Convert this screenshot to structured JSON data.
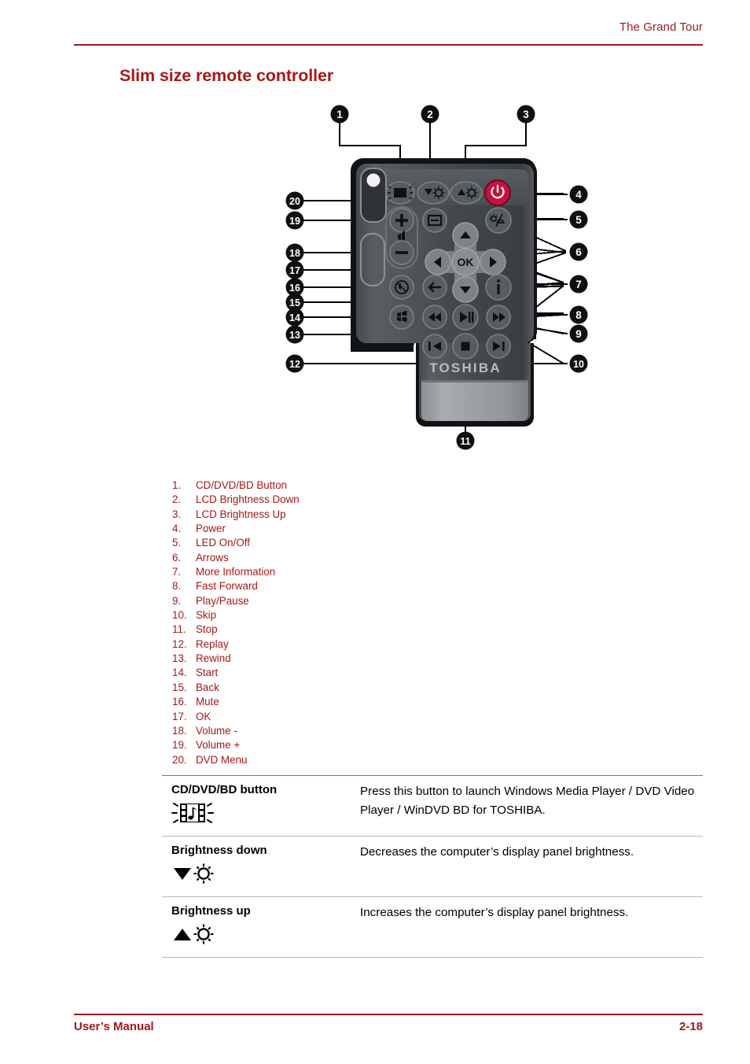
{
  "header": {
    "chapter_title": "The Grand Tour",
    "rule_color": "#9e1a1a"
  },
  "section": {
    "title": "Slim size remote controller",
    "title_color": "#a81818"
  },
  "figure": {
    "name": "slim-size-remote-controller-diagram",
    "brand_label": "TOSHIBA",
    "ok_label": "OK",
    "power_button_color": "#c8103c",
    "body_color": "#3f4246",
    "callouts": [
      {
        "n": "1",
        "target": "cd-dvd-bd-button"
      },
      {
        "n": "2",
        "target": "lcd-brightness-down"
      },
      {
        "n": "3",
        "target": "lcd-brightness-up"
      },
      {
        "n": "4",
        "target": "power"
      },
      {
        "n": "5",
        "target": "led-on-off"
      },
      {
        "n": "6",
        "target": "arrows"
      },
      {
        "n": "7",
        "target": "more-information"
      },
      {
        "n": "8",
        "target": "fast-forward"
      },
      {
        "n": "9",
        "target": "play-pause"
      },
      {
        "n": "10",
        "target": "skip"
      },
      {
        "n": "11",
        "target": "stop"
      },
      {
        "n": "12",
        "target": "replay"
      },
      {
        "n": "13",
        "target": "rewind"
      },
      {
        "n": "14",
        "target": "start"
      },
      {
        "n": "15",
        "target": "back"
      },
      {
        "n": "16",
        "target": "mute"
      },
      {
        "n": "17",
        "target": "ok"
      },
      {
        "n": "18",
        "target": "volume-down"
      },
      {
        "n": "19",
        "target": "volume-up"
      },
      {
        "n": "20",
        "target": "dvd-menu"
      }
    ]
  },
  "legend": {
    "items": [
      {
        "num": "1.",
        "label": "CD/DVD/BD Button"
      },
      {
        "num": "2.",
        "label": "LCD Brightness Down"
      },
      {
        "num": "3.",
        "label": "LCD Brightness Up"
      },
      {
        "num": "4.",
        "label": "Power"
      },
      {
        "num": "5.",
        "label": "LED On/Off"
      },
      {
        "num": "6.",
        "label": "Arrows"
      },
      {
        "num": "7.",
        "label": "More Information"
      },
      {
        "num": "8.",
        "label": "Fast Forward"
      },
      {
        "num": "9.",
        "label": "Play/Pause"
      },
      {
        "num": "10.",
        "label": "Skip"
      },
      {
        "num": "11.",
        "label": "Stop"
      },
      {
        "num": "12.",
        "label": "Replay"
      },
      {
        "num": "13.",
        "label": "Rewind"
      },
      {
        "num": "14.",
        "label": "Start"
      },
      {
        "num": "15.",
        "label": "Back"
      },
      {
        "num": "16.",
        "label": "Mute"
      },
      {
        "num": "17.",
        "label": "OK"
      },
      {
        "num": "18.",
        "label": "Volume -"
      },
      {
        "num": "19.",
        "label": "Volume +"
      },
      {
        "num": "20.",
        "label": "DVD Menu"
      }
    ]
  },
  "table": {
    "rows": [
      {
        "term": "CD/DVD/BD button",
        "icon": "film-music-icon",
        "description": "Press this button to launch Windows Media Player / DVD Video Player / WinDVD BD for TOSHIBA."
      },
      {
        "term": "Brightness down",
        "icon": "down-triangle-sun-icon",
        "description": "Decreases the computer’s display panel brightness."
      },
      {
        "term": "Brightness up",
        "icon": "up-triangle-sun-icon",
        "description": "Increases the computer’s display panel brightness."
      }
    ]
  },
  "footer": {
    "left": "User’s Manual",
    "page": "2-18"
  }
}
